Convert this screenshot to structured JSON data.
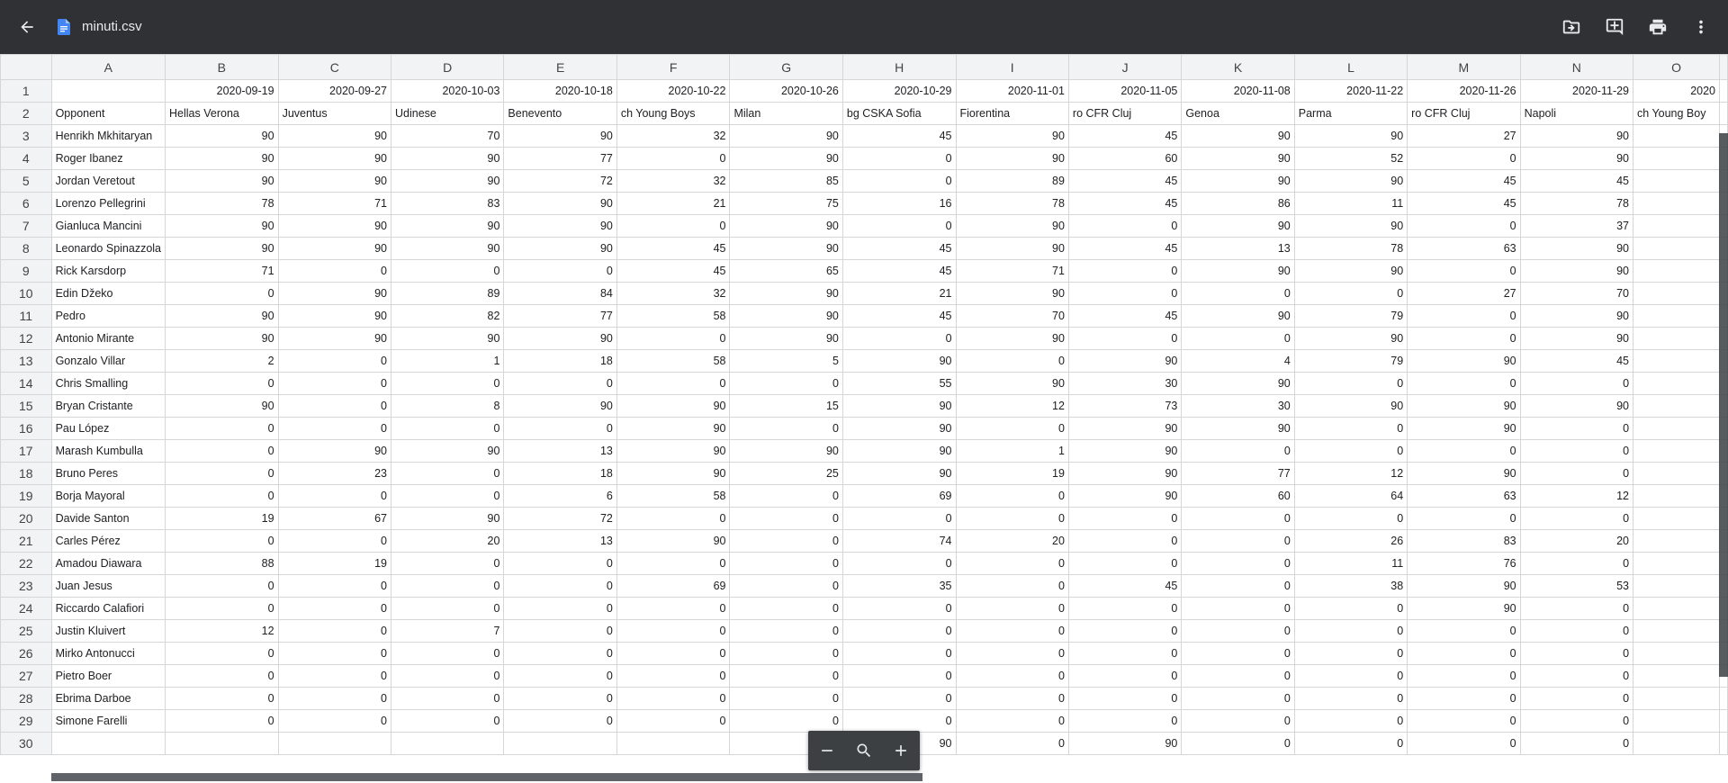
{
  "app": {
    "file_name": "minuti.csv"
  },
  "toolbar": {
    "icons": [
      "back-arrow-icon",
      "move-to-drive-icon",
      "add-comment-icon",
      "print-icon",
      "more-options-icon"
    ]
  },
  "colors": {
    "topbar": "#303134",
    "file_icon": "#4285f4",
    "header_bg": "#f1f3f4"
  },
  "sheet": {
    "column_letters": [
      "A",
      "B",
      "C",
      "D",
      "E",
      "F",
      "G",
      "H",
      "I",
      "J",
      "K",
      "L",
      "M",
      "N",
      "O"
    ],
    "rows": [
      {
        "n": "1",
        "cells": [
          "",
          "2020-09-19",
          "2020-09-27",
          "2020-10-03",
          "2020-10-18",
          "2020-10-22",
          "2020-10-26",
          "2020-10-29",
          "2020-11-01",
          "2020-11-05",
          "2020-11-08",
          "2020-11-22",
          "2020-11-26",
          "2020-11-29",
          "2020"
        ]
      },
      {
        "n": "2",
        "cells": [
          "Opponent",
          "Hellas Verona",
          "Juventus",
          "Udinese",
          "Benevento",
          "ch Young Boys",
          "Milan",
          "bg CSKA Sofia",
          "Fiorentina",
          "ro CFR Cluj",
          "Genoa",
          "Parma",
          "ro CFR Cluj",
          "Napoli",
          "ch Young Boy"
        ]
      },
      {
        "n": "3",
        "cells": [
          "Henrikh Mkhitaryan",
          "90",
          "90",
          "70",
          "90",
          "32",
          "90",
          "45",
          "90",
          "45",
          "90",
          "90",
          "27",
          "90",
          ""
        ]
      },
      {
        "n": "4",
        "cells": [
          "Roger Ibanez",
          "90",
          "90",
          "90",
          "77",
          "0",
          "90",
          "0",
          "90",
          "60",
          "90",
          "52",
          "0",
          "90",
          ""
        ]
      },
      {
        "n": "5",
        "cells": [
          "Jordan Veretout",
          "90",
          "90",
          "90",
          "72",
          "32",
          "85",
          "0",
          "89",
          "45",
          "90",
          "90",
          "45",
          "45",
          ""
        ]
      },
      {
        "n": "6",
        "cells": [
          "Lorenzo Pellegrini",
          "78",
          "71",
          "83",
          "90",
          "21",
          "75",
          "16",
          "78",
          "45",
          "86",
          "11",
          "45",
          "78",
          ""
        ]
      },
      {
        "n": "7",
        "cells": [
          "Gianluca Mancini",
          "90",
          "90",
          "90",
          "90",
          "0",
          "90",
          "0",
          "90",
          "0",
          "90",
          "90",
          "0",
          "37",
          ""
        ]
      },
      {
        "n": "8",
        "cells": [
          "Leonardo Spinazzola",
          "90",
          "90",
          "90",
          "90",
          "45",
          "90",
          "45",
          "90",
          "45",
          "13",
          "78",
          "63",
          "90",
          ""
        ]
      },
      {
        "n": "9",
        "cells": [
          "Rick Karsdorp",
          "71",
          "0",
          "0",
          "0",
          "45",
          "65",
          "45",
          "71",
          "0",
          "90",
          "90",
          "0",
          "90",
          ""
        ]
      },
      {
        "n": "10",
        "cells": [
          "Edin Džeko",
          "0",
          "90",
          "89",
          "84",
          "32",
          "90",
          "21",
          "90",
          "0",
          "0",
          "0",
          "27",
          "70",
          ""
        ]
      },
      {
        "n": "11",
        "cells": [
          "Pedro",
          "90",
          "90",
          "82",
          "77",
          "58",
          "90",
          "45",
          "70",
          "45",
          "90",
          "79",
          "0",
          "90",
          ""
        ]
      },
      {
        "n": "12",
        "cells": [
          "Antonio Mirante",
          "90",
          "90",
          "90",
          "90",
          "0",
          "90",
          "0",
          "90",
          "0",
          "0",
          "90",
          "0",
          "90",
          ""
        ]
      },
      {
        "n": "13",
        "cells": [
          "Gonzalo Villar",
          "2",
          "0",
          "1",
          "18",
          "58",
          "5",
          "90",
          "0",
          "90",
          "4",
          "79",
          "90",
          "45",
          ""
        ]
      },
      {
        "n": "14",
        "cells": [
          "Chris Smalling",
          "0",
          "0",
          "0",
          "0",
          "0",
          "0",
          "55",
          "90",
          "30",
          "90",
          "0",
          "0",
          "0",
          ""
        ]
      },
      {
        "n": "15",
        "cells": [
          "Bryan Cristante",
          "90",
          "0",
          "8",
          "90",
          "90",
          "15",
          "90",
          "12",
          "73",
          "30",
          "90",
          "90",
          "90",
          ""
        ]
      },
      {
        "n": "16",
        "cells": [
          "Pau López",
          "0",
          "0",
          "0",
          "0",
          "90",
          "0",
          "90",
          "0",
          "90",
          "90",
          "0",
          "90",
          "0",
          ""
        ]
      },
      {
        "n": "17",
        "cells": [
          "Marash Kumbulla",
          "0",
          "90",
          "90",
          "13",
          "90",
          "90",
          "90",
          "1",
          "90",
          "0",
          "0",
          "0",
          "0",
          ""
        ]
      },
      {
        "n": "18",
        "cells": [
          "Bruno Peres",
          "0",
          "23",
          "0",
          "18",
          "90",
          "25",
          "90",
          "19",
          "90",
          "77",
          "12",
          "90",
          "0",
          ""
        ]
      },
      {
        "n": "19",
        "cells": [
          "Borja Mayoral",
          "0",
          "0",
          "0",
          "6",
          "58",
          "0",
          "69",
          "0",
          "90",
          "60",
          "64",
          "63",
          "12",
          ""
        ]
      },
      {
        "n": "20",
        "cells": [
          "Davide Santon",
          "19",
          "67",
          "90",
          "72",
          "0",
          "0",
          "0",
          "0",
          "0",
          "0",
          "0",
          "0",
          "0",
          ""
        ]
      },
      {
        "n": "21",
        "cells": [
          "Carles Pérez",
          "0",
          "0",
          "20",
          "13",
          "90",
          "0",
          "74",
          "20",
          "0",
          "0",
          "26",
          "83",
          "20",
          ""
        ]
      },
      {
        "n": "22",
        "cells": [
          "Amadou Diawara",
          "88",
          "19",
          "0",
          "0",
          "0",
          "0",
          "0",
          "0",
          "0",
          "0",
          "11",
          "76",
          "0",
          ""
        ]
      },
      {
        "n": "23",
        "cells": [
          "Juan Jesus",
          "0",
          "0",
          "0",
          "0",
          "69",
          "0",
          "35",
          "0",
          "45",
          "0",
          "38",
          "90",
          "53",
          ""
        ]
      },
      {
        "n": "24",
        "cells": [
          "Riccardo Calafiori",
          "0",
          "0",
          "0",
          "0",
          "0",
          "0",
          "0",
          "0",
          "0",
          "0",
          "0",
          "90",
          "0",
          ""
        ]
      },
      {
        "n": "25",
        "cells": [
          "Justin Kluivert",
          "12",
          "0",
          "7",
          "0",
          "0",
          "0",
          "0",
          "0",
          "0",
          "0",
          "0",
          "0",
          "0",
          ""
        ]
      },
      {
        "n": "26",
        "cells": [
          "Mirko Antonucci",
          "0",
          "0",
          "0",
          "0",
          "0",
          "0",
          "0",
          "0",
          "0",
          "0",
          "0",
          "0",
          "0",
          ""
        ]
      },
      {
        "n": "27",
        "cells": [
          "Pietro Boer",
          "0",
          "0",
          "0",
          "0",
          "0",
          "0",
          "0",
          "0",
          "0",
          "0",
          "0",
          "0",
          "0",
          ""
        ]
      },
      {
        "n": "28",
        "cells": [
          "Ebrima Darboe",
          "0",
          "0",
          "0",
          "0",
          "0",
          "0",
          "0",
          "0",
          "0",
          "0",
          "0",
          "0",
          "0",
          ""
        ]
      },
      {
        "n": "29",
        "cells": [
          "Simone Farelli",
          "0",
          "0",
          "0",
          "0",
          "0",
          "0",
          "0",
          "0",
          "0",
          "0",
          "0",
          "0",
          "0",
          ""
        ]
      },
      {
        "n": "30",
        "cells": [
          "",
          "",
          "",
          "",
          "",
          "",
          "",
          "90",
          "0",
          "90",
          "0",
          "0",
          "0",
          "0",
          ""
        ]
      }
    ]
  },
  "zoom_controls": {
    "icons": [
      "zoom-out-icon",
      "zoom-reset-icon",
      "zoom-in-icon"
    ]
  }
}
